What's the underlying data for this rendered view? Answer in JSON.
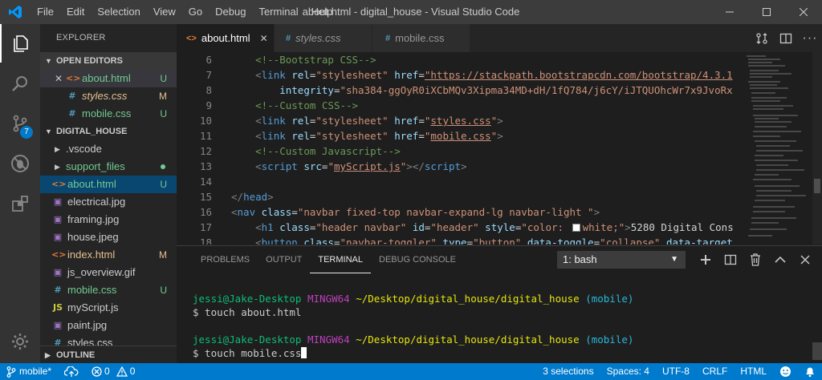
{
  "titlebar": {
    "menu": [
      "File",
      "Edit",
      "Selection",
      "View",
      "Go",
      "Debug",
      "Terminal",
      "Help"
    ],
    "window_title": "about.html - digital_house - Visual Studio Code"
  },
  "activity": {
    "scm_badge": "7"
  },
  "sidebar": {
    "title": "EXPLORER",
    "open_editors_title": "OPEN EDITORS",
    "open_editors": [
      {
        "name": "about.html",
        "status": "U",
        "type": "html"
      },
      {
        "name": "styles.css",
        "status": "M",
        "type": "css"
      },
      {
        "name": "mobile.css",
        "status": "U",
        "type": "css"
      }
    ],
    "folder_title": "DIGITAL_HOUSE",
    "files": [
      {
        "name": ".vscode",
        "status": "",
        "type": "folder"
      },
      {
        "name": "support_files",
        "status": "",
        "type": "folder"
      },
      {
        "name": "about.html",
        "status": "U",
        "type": "html"
      },
      {
        "name": "electrical.jpg",
        "status": "",
        "type": "image"
      },
      {
        "name": "framing.jpg",
        "status": "",
        "type": "image"
      },
      {
        "name": "house.jpeg",
        "status": "",
        "type": "image"
      },
      {
        "name": "index.html",
        "status": "M",
        "type": "html"
      },
      {
        "name": "js_overview.gif",
        "status": "",
        "type": "image"
      },
      {
        "name": "mobile.css",
        "status": "U",
        "type": "css"
      },
      {
        "name": "myScript.js",
        "status": "",
        "type": "js"
      },
      {
        "name": "paint.jpg",
        "status": "",
        "type": "image"
      },
      {
        "name": "styles.css",
        "status": "",
        "type": "css"
      }
    ],
    "outline_title": "OUTLINE"
  },
  "tabs": [
    {
      "label": "about.html",
      "type": "html"
    },
    {
      "label": "styles.css",
      "type": "css"
    },
    {
      "label": "mobile.css",
      "type": "css"
    }
  ],
  "editor": {
    "line_numbers": [
      "6",
      "7",
      "8",
      "9",
      "10",
      "11",
      "12",
      "13",
      "14",
      "15",
      "16",
      "17",
      "18"
    ],
    "code": {
      "l6": "<!--Bootstrap CSS-->",
      "l7_href": "\"https://stackpath.bootstrapcdn.com/bootstrap/4.3.1",
      "l8_integrity": "\"sha384-ggOyR0iXCbMQv3Xipma34MD+dH/1fQ784/j6cY/iJTQUOhcWr7x9JvoRx",
      "l9": "<!--Custom CSS-->",
      "l10_href": "styles.css",
      "l11_href": "mobile.css",
      "l12": "<!--Custom Javascript-->",
      "l13_src": "myScript.js",
      "l16_class": "\"navbar fixed-top navbar-expand-lg navbar-light \"",
      "l17_class": "\"header navbar\"",
      "l17_id": "\"header\"",
      "l17_style_a": "\"color: ",
      "l17_style_b": "white;\"",
      "l17_text": "5280 Digital Cons",
      "l18_class": "\"navbar-toggler\"",
      "l18_type": "\"button\"",
      "l18_toggle": "\"collapse\"",
      "l18_target": "data-target"
    }
  },
  "panel": {
    "tabs": [
      "PROBLEMS",
      "OUTPUT",
      "TERMINAL",
      "DEBUG CONSOLE"
    ],
    "terminal_select": "1: bash",
    "lines": [
      {
        "user": "jessi@Jake-Desktop",
        "sys": "MINGW64",
        "path": "~/Desktop/digital_house/digital_house",
        "branch": "(mobile)",
        "cmd": "$ touch about.html"
      },
      {
        "user": "jessi@Jake-Desktop",
        "sys": "MINGW64",
        "path": "~/Desktop/digital_house/digital_house",
        "branch": "(mobile)",
        "cmd": "$ touch mobile.css"
      }
    ]
  },
  "statusbar": {
    "branch": "mobile*",
    "errors": "0",
    "warnings": "0",
    "selections": "3 selections",
    "spaces": "Spaces: 4",
    "encoding": "UTF-8",
    "eol": "CRLF",
    "language": "HTML"
  },
  "colors": {
    "accent": "#007acc",
    "html_icon": "#e37933",
    "css_icon": "#519aba",
    "js_icon": "#cbcb41",
    "image_icon": "#a074c4",
    "untracked": "#73c991",
    "modified": "#e2c08d"
  }
}
